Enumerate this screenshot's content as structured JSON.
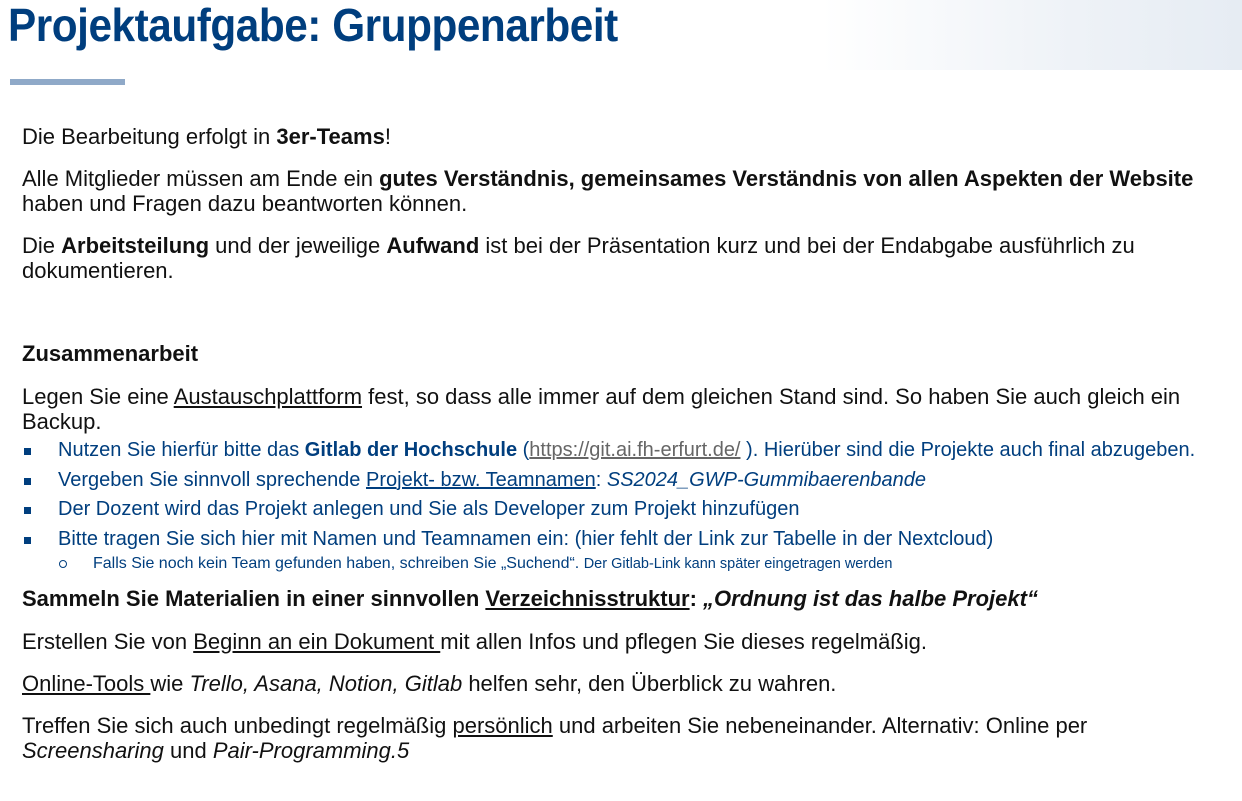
{
  "title": "Projektaufgabe: Gruppenarbeit",
  "para1": {
    "pre": "Die Bearbeitung erfolgt in ",
    "bold": "3er-Teams",
    "post": "!"
  },
  "para2": {
    "pre": "Alle Mitglieder müssen am Ende ein ",
    "bold": "gutes Verständnis, gemeinsames Verständnis von allen Aspekten der Website",
    "post": " haben und Fragen dazu beantworten können."
  },
  "para3": {
    "pre": "Die ",
    "bold1": "Arbeitsteilung",
    "mid": " und der jeweilige ",
    "bold2": "Aufwand",
    "post": " ist bei der Präsentation kurz und bei der Endabgabe ausführlich zu dokumentieren."
  },
  "heading_zusammenarbeit": "Zusammenarbeit",
  "para4": {
    "pre": "Legen Sie eine ",
    "underline": "Austauschplattform",
    "post": " fest, so dass alle immer auf dem gleichen Stand sind. So haben Sie auch gleich ein Backup."
  },
  "bullets": {
    "b1": {
      "pre": "Nutzen Sie hierfür bitte das ",
      "bold": "Gitlab der Hochschule",
      "open": " (",
      "link": "https://git.ai.fh-erfurt.de/",
      "post": " ). Hierüber sind die Projekte auch final abzugeben."
    },
    "b2": {
      "pre": "Vergeben Sie sinnvoll sprechende ",
      "underline": "Projekt- bzw. Teamnamen",
      "colon": ": ",
      "italic": "SS2024_GWP-Gummibaerenbande"
    },
    "b3": "Der Dozent wird das Projekt anlegen und Sie als Developer zum Projekt hinzufügen",
    "b4": "Bitte tragen Sie sich hier mit Namen und Teamnamen ein: (hier fehlt der Link zur Tabelle in der Nextcloud)",
    "sub1": {
      "text": "Falls Sie noch kein Team gefunden haben, schreiben Sie „Suchend“. ",
      "small": "Der Gitlab-Link kann später eingetragen werden"
    }
  },
  "heading_material": {
    "pre": "Sammeln Sie Materialien in einer sinnvollen ",
    "underline": "Verzeichnisstruktur",
    "colon": ": ",
    "italic": "„Ordnung ist das halbe Projekt“"
  },
  "para5": {
    "pre": "Erstellen Sie von ",
    "underline": "Beginn an ein Dokument ",
    "post": "mit allen Infos und pflegen Sie dieses regelmäßig."
  },
  "para6": {
    "underline": "Online-Tools ",
    "mid": "wie ",
    "italic": "Trello, Asana, Notion, Gitlab",
    "post": " helfen sehr, den Überblick zu wahren."
  },
  "para7": {
    "pre": "Treffen Sie sich auch unbedingt regelmäßig ",
    "underline": "persönlich",
    "mid": " und arbeiten Sie nebeneinander. Alternativ: Online per ",
    "italic1": "Screensharing",
    "and": " und ",
    "italic2": "Pair-Programming.5"
  },
  "colors": {
    "title": "#003e7e",
    "accent_rule": "#8fa9c8",
    "bullet_text": "#003e7e",
    "link": "#666666"
  }
}
